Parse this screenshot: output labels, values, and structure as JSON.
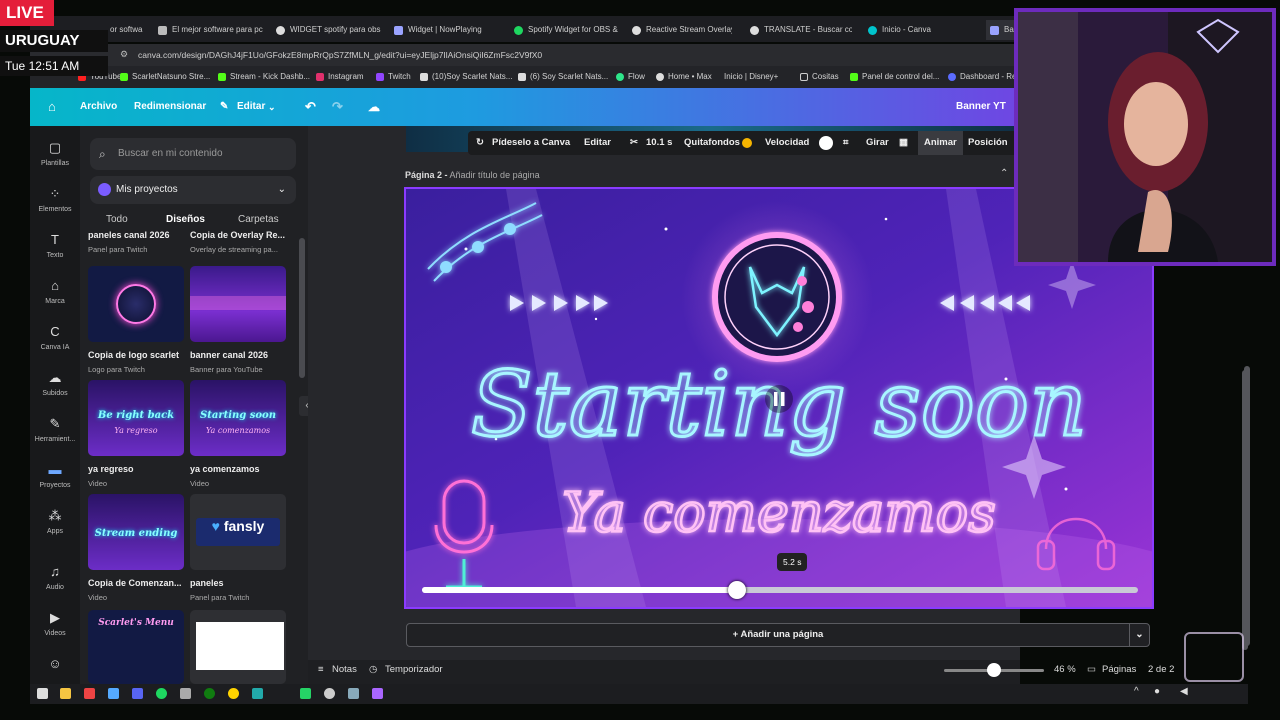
{
  "stream": {
    "live": "LIVE",
    "country": "URUGUAY",
    "time": "Tue 12:51 AM"
  },
  "browser": {
    "tabs": [
      "or softwa",
      "El mejor software para pc",
      "WIDGET spotify para obs",
      "Widget | NowPlaying",
      "Spotify Widget for OBS &",
      "Reactive Stream Overlays",
      "TRANSLATE - Buscar con",
      "Inicio - Canva",
      "Bar"
    ],
    "url": "canva.com/design/DAGhJ4jF1Uo/GFokzE8mpRrQpS7ZfMLN_g/edit?ui=eyJEljp7IlAiOnsiQiI6ZmFsc2V9fX0",
    "bookmarks": [
      "YouTube",
      "ScarletNatsuno Stre...",
      "Stream - Kick Dashb...",
      "Instagram",
      "Twitch",
      "(10)Soy Scarlet Nats...",
      "(6) Soy Scarlet Nats...",
      "Flow",
      "Home • Max",
      "Inicio | Disney+",
      "Cositas",
      "Panel de control del...",
      "Dashboard - Re"
    ]
  },
  "canva": {
    "header": {
      "file": "Archivo",
      "resize": "Redimensionar",
      "edit": "Editar",
      "title": "Banner YT"
    },
    "rail": [
      "Plantillas",
      "Elementos",
      "Texto",
      "Marca",
      "Canva IA",
      "Subidos",
      "Herramient...",
      "Proyectos",
      "Apps",
      "Audio",
      "Videos"
    ],
    "panel": {
      "search_placeholder": "Buscar en mi contenido",
      "projects": "Mis proyectos",
      "tabs": [
        "Todo",
        "Diseños",
        "Carpetas"
      ],
      "cards": [
        {
          "title": "paneles canal 2026",
          "sub": "Panel para Twitch"
        },
        {
          "title": "Copia de Overlay Re...",
          "sub": "Overlay de streaming pa..."
        },
        {
          "title": "Copia de logo  scarlet",
          "sub": "Logo para Twitch"
        },
        {
          "title": "banner canal 2026",
          "sub": "Banner para YouTube"
        },
        {
          "title": "ya regreso",
          "sub": "Video"
        },
        {
          "title": "ya comenzamos",
          "sub": "Video"
        },
        {
          "title": "Copia de Comenzan...",
          "sub": "Video"
        },
        {
          "title": "paneles",
          "sub": "Panel para Twitch"
        }
      ],
      "thumb_texts": {
        "brb": "Be right back",
        "brb2": "Ya regreso",
        "ss": "Starting soon",
        "ss2": "Ya comenzamos",
        "se": "Stream ending",
        "fansly": "fansly",
        "menu": "Scarlet's Menu"
      }
    },
    "toolbar": {
      "ask": "Pídeselo a Canva",
      "edit": "Editar",
      "duration": "10.1 s",
      "bgremove": "Quitafondos",
      "speed": "Velocidad",
      "rotate": "Girar",
      "animate": "Animar",
      "position": "Posición"
    },
    "page": {
      "label": "Página 2 -",
      "add_title": "Añadir título de página"
    },
    "artwork": {
      "title": "Starting soon",
      "subtitle": "Ya comenzamos"
    },
    "scrubber": {
      "time_label": "5.2 s",
      "progress": 0.44
    },
    "add_page": "+ Añadir una página",
    "footer": {
      "notes": "Notas",
      "timer": "Temporizador",
      "zoom": "46 %",
      "pages": "Páginas",
      "page_count": "2 de 2",
      "zoom_level": 0.5
    }
  },
  "colors": {
    "accent": "#8b3bff",
    "live": "#e41e3a",
    "neon_cyan": "#7df3ff",
    "neon_pink": "#ff9bf1"
  }
}
